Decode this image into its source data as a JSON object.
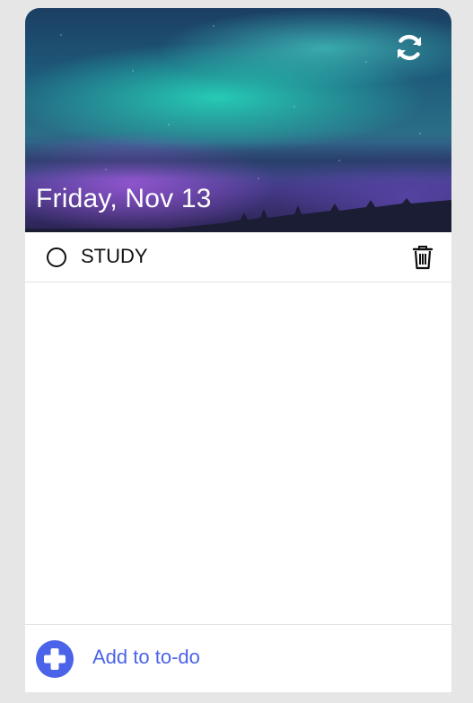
{
  "header": {
    "date_title": "Friday, Nov 13",
    "background_description_icon": "aurora-night-sky-image",
    "refresh_icon": "refresh-icon"
  },
  "todos": [
    {
      "text": "STUDY",
      "completed": false,
      "status_icon": "empty-circle-icon",
      "delete_icon": "trash-icon"
    }
  ],
  "footer": {
    "add_label": "Add to to-do",
    "add_icon": "plus-circle-icon"
  },
  "colors": {
    "accent": "#4a63e8",
    "page_background": "#e6e6e6",
    "card_background": "#ffffff",
    "text": "#111111"
  }
}
